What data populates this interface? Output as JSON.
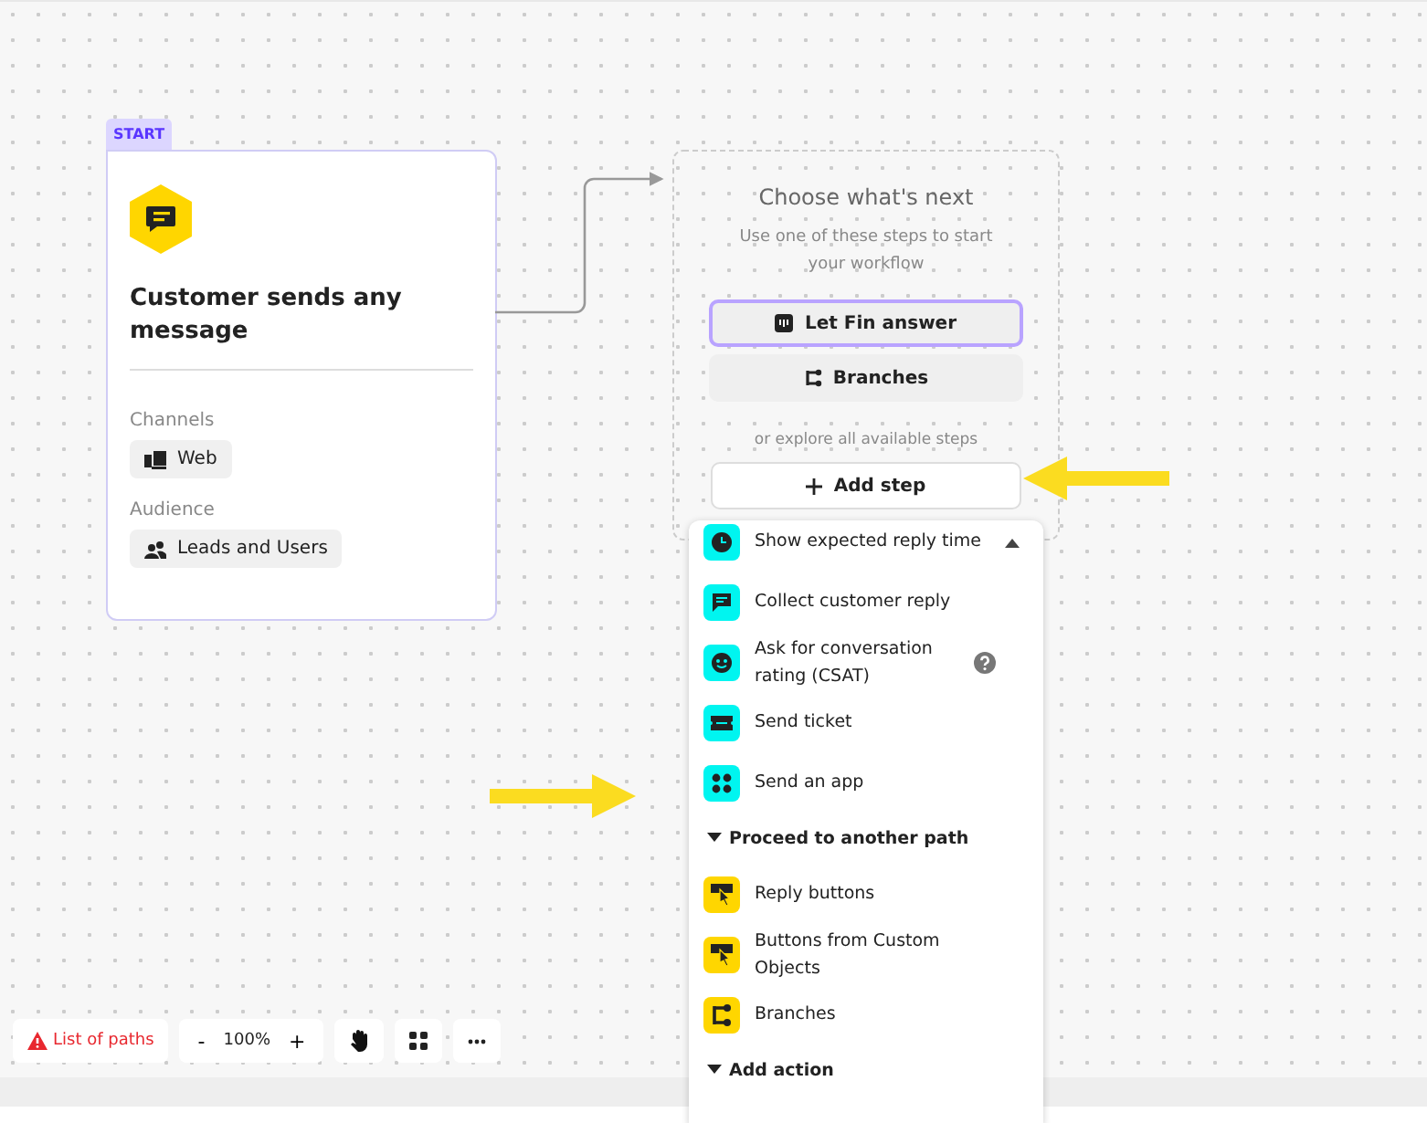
{
  "start_node": {
    "badge": "START",
    "title": "Customer sends any message",
    "channels_label": "Channels",
    "channels": [
      "Web"
    ],
    "audience_label": "Audience",
    "audience": [
      "Leads and Users"
    ]
  },
  "next_node": {
    "title": "Choose what's next",
    "subtitle": "Use one of these steps to start your workflow",
    "options": [
      {
        "label": "Let Fin answer",
        "selected": true,
        "kind": "fin"
      },
      {
        "label": "Branches",
        "selected": false,
        "kind": "branches"
      }
    ],
    "explore": "or explore all available steps",
    "add_button": "Add step"
  },
  "step_menu": [
    {
      "kind": "item",
      "label": "Show expected reply time",
      "color": "#00f5f0",
      "help": false
    },
    {
      "kind": "item",
      "label": "Collect customer reply",
      "color": "#00f5f0",
      "help": false
    },
    {
      "kind": "item",
      "label": "Ask for conversation rating (CSAT)",
      "color": "#00f5f0",
      "help": true
    },
    {
      "kind": "item",
      "label": "Send ticket",
      "color": "#00f5f0",
      "help": false
    },
    {
      "kind": "item",
      "label": "Send an app",
      "color": "#00f5f0",
      "help": false
    },
    {
      "kind": "header",
      "label": "Proceed to another path"
    },
    {
      "kind": "item",
      "label": "Reply buttons",
      "color": "#ffd600",
      "help": false
    },
    {
      "kind": "item",
      "label": "Buttons from Custom Objects",
      "color": "#ffd600",
      "help": false
    },
    {
      "kind": "item",
      "label": "Branches",
      "color": "#ffd600",
      "help": false
    },
    {
      "kind": "header",
      "label": "Add action"
    }
  ],
  "toolbar": {
    "paths_button": "List of paths",
    "zoom_out": "-",
    "zoom_level": "100%",
    "zoom_in": "+"
  }
}
